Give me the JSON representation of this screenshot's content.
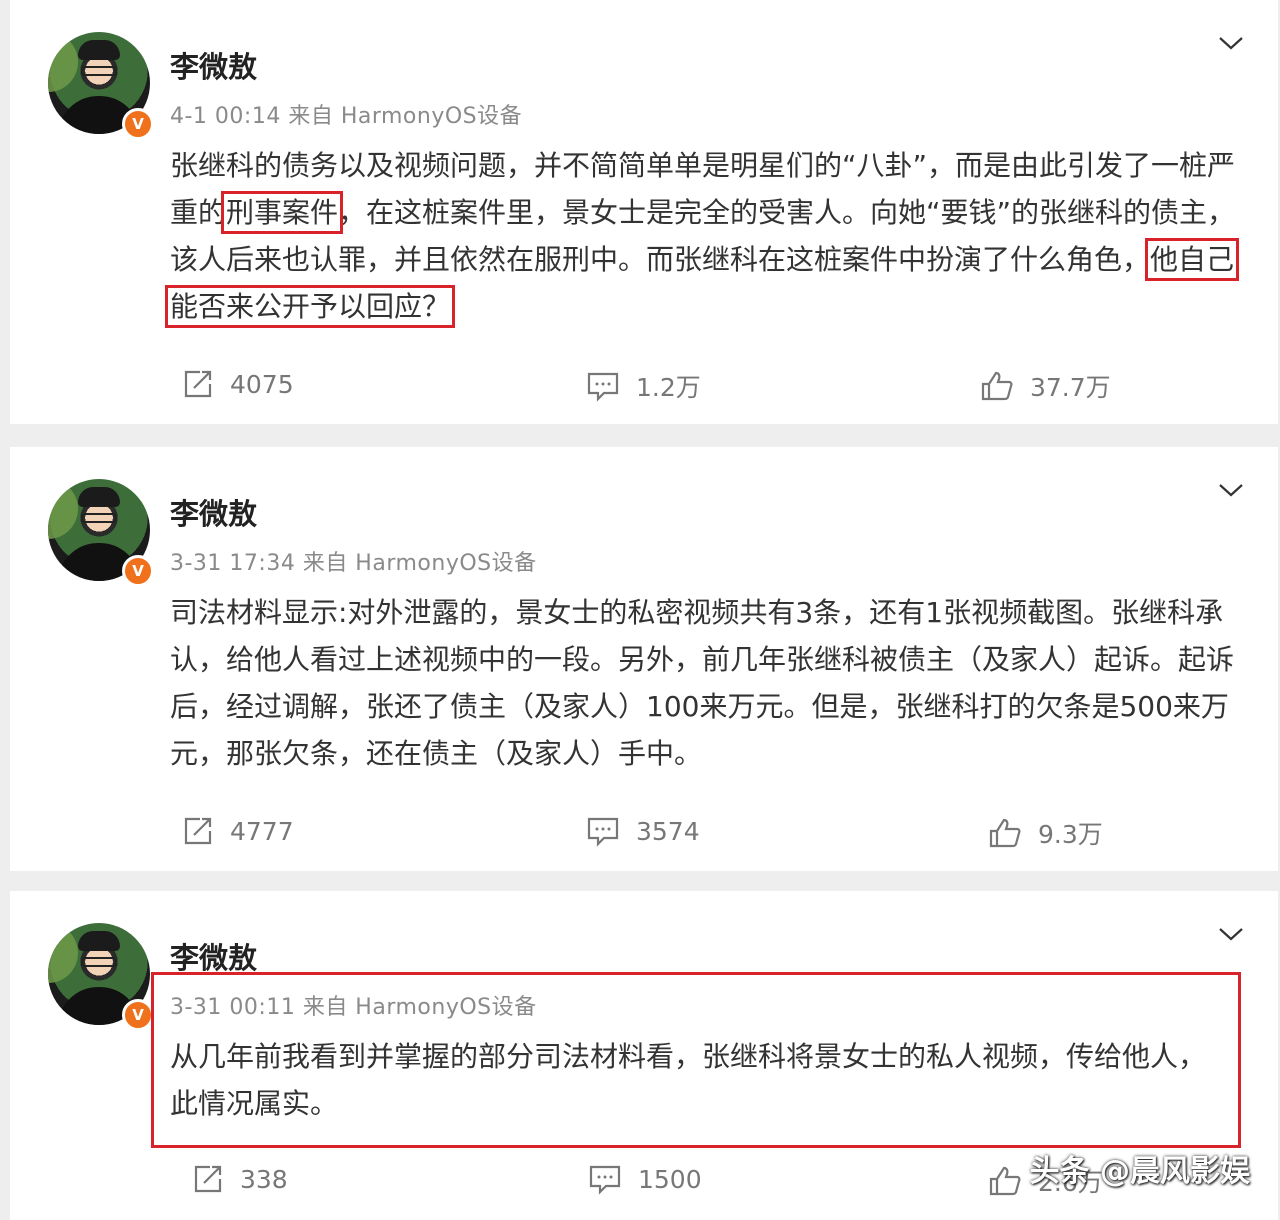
{
  "posts": [
    {
      "author": "李微敖",
      "meta": "4-1 00:14 来自 HarmonyOS设备",
      "segments": [
        "张继科的债务以及视频问题，并不简简单单是明星们的“八卦”，而是由此引发了一桩严重的",
        "刑事案件",
        "，在这桩案件里，景女士是完全的受害人。向她“要钱”的张继科的债主，该人后来也认罪，并且依然在服刑中。而张继科在这桩案件中扮演了什么角色，",
        "他自己能否来公开予以回应？"
      ],
      "reposts": "4075",
      "comments": "1.2万",
      "likes": "37.7万"
    },
    {
      "author": "李微敖",
      "meta": "3-31 17:34 来自 HarmonyOS设备",
      "text": "司法材料显示:对外泄露的，景女士的私密视频共有3条，还有1张视频截图。张继科承认，给他人看过上述视频中的一段。另外，前几年张继科被债主（及家人）起诉。起诉后，经过调解，张还了债主（及家人）100来万元。但是，张继科打的欠条是500来万元，那张欠条，还在债主（及家人）手中。",
      "reposts": "4777",
      "comments": "3574",
      "likes": "9.3万"
    },
    {
      "author": "李微敖",
      "meta": "3-31 00:11 来自 HarmonyOS设备",
      "text": "从几年前我看到并掌握的部分司法材料看，张继科将景女士的私人视频，传给他人，此情况属实。",
      "reposts": "338",
      "comments": "1500",
      "likes": "2.6万"
    }
  ],
  "verified_badge": "V",
  "watermark": "头条 @晨风影娱",
  "colors": {
    "highlight": "#d8232a",
    "badge": "#f0711c"
  },
  "icons": [
    "chevron-down-icon",
    "repost-icon",
    "comment-icon",
    "like-icon",
    "verified-badge-icon"
  ]
}
